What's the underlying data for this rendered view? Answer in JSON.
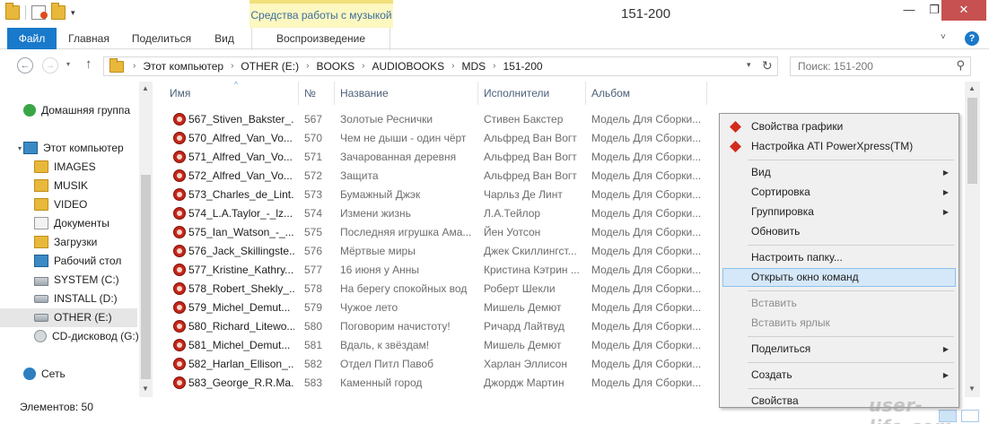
{
  "window": {
    "title": "151-200",
    "contextual_tab_header": "Средства работы с музыкой",
    "minimize_glyph": "—",
    "maximize_glyph": "❐",
    "close_glyph": "✕"
  },
  "ribbon": {
    "tabs": [
      {
        "label": "Файл",
        "active": true
      },
      {
        "label": "Главная"
      },
      {
        "label": "Поделиться"
      },
      {
        "label": "Вид"
      },
      {
        "label": "Воспроизведение"
      }
    ],
    "expand_glyph": "˅",
    "help_glyph": "?"
  },
  "address": {
    "breadcrumbs": [
      "Этот компьютер",
      "OTHER (E:)",
      "BOOKS",
      "AUDIOBOOKS",
      "MDS",
      "151-200"
    ],
    "separator": "›",
    "search_placeholder": "Поиск: 151-200"
  },
  "navpane": {
    "items": [
      {
        "label": "Домашняя группа",
        "icon": "homegroup-icon",
        "level": 0
      },
      {
        "label": "Этот компьютер",
        "icon": "computer-icon",
        "level": 0
      },
      {
        "label": "IMAGES",
        "icon": "folder-icon",
        "level": 1
      },
      {
        "label": "MUSIK",
        "icon": "music-folder-icon",
        "level": 1
      },
      {
        "label": "VIDEO",
        "icon": "folder-icon",
        "level": 1
      },
      {
        "label": "Документы",
        "icon": "documents-icon",
        "level": 1
      },
      {
        "label": "Загрузки",
        "icon": "downloads-icon",
        "level": 1
      },
      {
        "label": "Рабочий стол",
        "icon": "desktop-icon",
        "level": 1
      },
      {
        "label": "SYSTEM (C:)",
        "icon": "system-drive-icon",
        "level": 1
      },
      {
        "label": "INSTALL (D:)",
        "icon": "drive-icon",
        "level": 1
      },
      {
        "label": "OTHER (E:)",
        "icon": "drive-icon",
        "level": 1,
        "selected": true
      },
      {
        "label": "CD-дисковод (G:)",
        "icon": "cd-drive-icon",
        "level": 1
      },
      {
        "label": "Сеть",
        "icon": "network-icon",
        "level": 0
      }
    ]
  },
  "filelist": {
    "columns": [
      "Имя",
      "№",
      "Название",
      "Исполнители",
      "Альбом"
    ],
    "rows": [
      {
        "name": "567_Stiven_Bakster_...",
        "num": "567",
        "title": "Золотые Реснички",
        "artist": "Стивен Бакстер",
        "album": "Модель Для Сборки..."
      },
      {
        "name": "570_Alfred_Van_Vo...",
        "num": "570",
        "title": "Чем не дыши - один чёрт",
        "artist": "Альфред Ван Вогт",
        "album": "Модель Для Сборки..."
      },
      {
        "name": "571_Alfred_Van_Vo...",
        "num": "571",
        "title": "Зачарованная деревня",
        "artist": "Альфред Ван Вогт",
        "album": "Модель Для Сборки..."
      },
      {
        "name": "572_Alfred_Van_Vo...",
        "num": "572",
        "title": "Защита",
        "artist": "Альфред Ван Вогт",
        "album": "Модель Для Сборки..."
      },
      {
        "name": "573_Charles_de_Lint...",
        "num": "573",
        "title": "Бумажный Джэк",
        "artist": "Чарльз Де Линт",
        "album": "Модель Для Сборки..."
      },
      {
        "name": "574_L.A.Taylor_-_lz...",
        "num": "574",
        "title": "Измени жизнь",
        "artist": "Л.А.Тейлор",
        "album": "Модель Для Сборки..."
      },
      {
        "name": "575_Ian_Watson_-_...",
        "num": "575",
        "title": "Последняя игрушка Ама...",
        "artist": "Йен Уотсон",
        "album": "Модель Для Сборки..."
      },
      {
        "name": "576_Jack_Skillingste...",
        "num": "576",
        "title": "Мёртвые миры",
        "artist": "Джек Скиллингст...",
        "album": "Модель Для Сборки..."
      },
      {
        "name": "577_Kristine_Kathry...",
        "num": "577",
        "title": "16 июня у Анны",
        "artist": "Кристина Кэтрин ...",
        "album": "Модель Для Сборки..."
      },
      {
        "name": "578_Robert_Shekly_...",
        "num": "578",
        "title": "На берегу спокойных вод",
        "artist": "Роберт Шекли",
        "album": "Модель Для Сборки..."
      },
      {
        "name": "579_Michel_Demut...",
        "num": "579",
        "title": "Чужое лето",
        "artist": "Мишель Демют",
        "album": "Модель Для Сборки..."
      },
      {
        "name": "580_Richard_Litewo...",
        "num": "580",
        "title": "Поговорим начистоту!",
        "artist": "Ричард Лайтвуд",
        "album": "Модель Для Сборки..."
      },
      {
        "name": "581_Michel_Demut...",
        "num": "581",
        "title": "Вдаль, к звёздам!",
        "artist": "Мишель Демют",
        "album": "Модель Для Сборки..."
      },
      {
        "name": "582_Harlan_Ellison_...",
        "num": "582",
        "title": "Отдел Питл Павоб",
        "artist": "Харлан Эллисон",
        "album": "Модель Для Сборки..."
      },
      {
        "name": "583_George_R.R.Ma...",
        "num": "583",
        "title": "Каменный город",
        "artist": "Джордж Мартин",
        "album": "Модель Для Сборки..."
      }
    ]
  },
  "context_menu": {
    "items": [
      {
        "label": "Свойства графики",
        "type": "item",
        "icon": "ati-icon"
      },
      {
        "label": "Настройка ATI PowerXpress(TM)",
        "type": "item",
        "icon": "ati-icon"
      },
      {
        "type": "separator"
      },
      {
        "label": "Вид",
        "type": "submenu"
      },
      {
        "label": "Сортировка",
        "type": "submenu"
      },
      {
        "label": "Группировка",
        "type": "submenu"
      },
      {
        "label": "Обновить",
        "type": "item"
      },
      {
        "type": "separator"
      },
      {
        "label": "Настроить папку...",
        "type": "item"
      },
      {
        "label": "Открыть окно команд",
        "type": "item",
        "highlight": true
      },
      {
        "type": "separator"
      },
      {
        "label": "Вставить",
        "type": "item",
        "disabled": true
      },
      {
        "label": "Вставить ярлык",
        "type": "item",
        "disabled": true
      },
      {
        "type": "separator"
      },
      {
        "label": "Поделиться",
        "type": "submenu"
      },
      {
        "type": "separator"
      },
      {
        "label": "Создать",
        "type": "submenu"
      },
      {
        "type": "separator"
      },
      {
        "label": "Свойства",
        "type": "item"
      }
    ],
    "submenu_glyph": "▶"
  },
  "status": {
    "count_text": "Элементов: 50"
  },
  "watermark": "user-life.com"
}
